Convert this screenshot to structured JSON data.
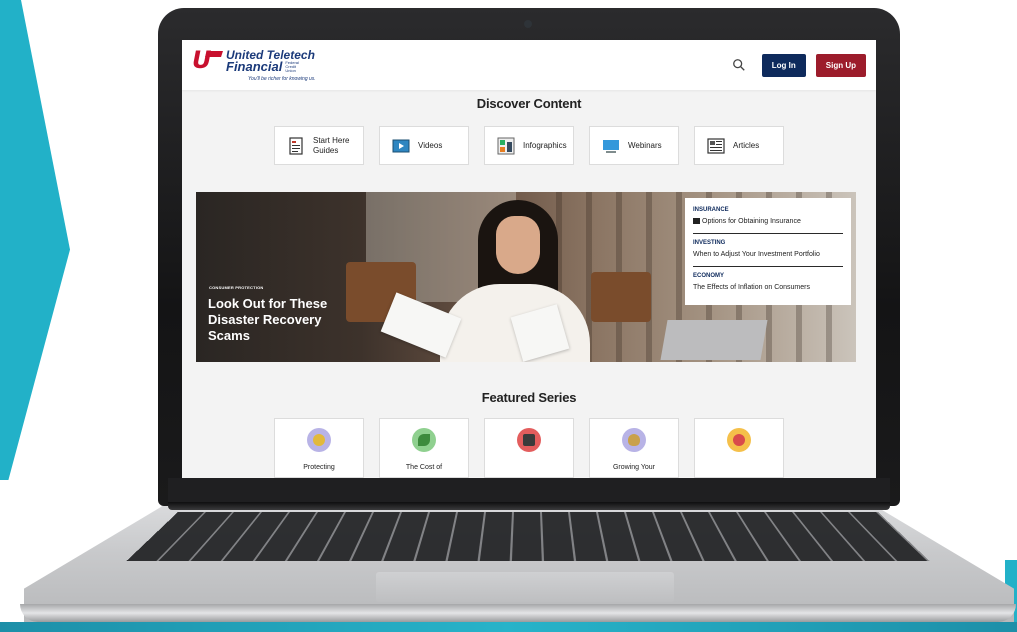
{
  "site": {
    "logo": {
      "line1": "United Teletech",
      "line2": "Financial",
      "small": "Federal Credit Union",
      "tagline": "You'll be richer for knowing us."
    },
    "header": {
      "login_label": "Log In",
      "signup_label": "Sign Up"
    },
    "discover": {
      "title": "Discover Content",
      "types": [
        {
          "label": "Start Here Guides",
          "icon": "guide-document-icon"
        },
        {
          "label": "Videos",
          "icon": "video-player-icon"
        },
        {
          "label": "Infographics",
          "icon": "infographic-icon"
        },
        {
          "label": "Webinars",
          "icon": "webinar-monitor-icon"
        },
        {
          "label": "Articles",
          "icon": "article-icon"
        }
      ]
    },
    "hero": {
      "eyebrow": "CONSUMER PROTECTION",
      "headline": "Look Out for These Disaster Recovery Scams"
    },
    "side_list": [
      {
        "category": "INSURANCE",
        "title": "Options for Obtaining Insurance"
      },
      {
        "category": "INVESTING",
        "title": "When to Adjust Your Investment Portfolio"
      },
      {
        "category": "ECONOMY",
        "title": "The Effects of Inflation on Consumers"
      }
    ],
    "featured": {
      "title": "Featured Series",
      "series": [
        {
          "label": "Protecting",
          "icon": "protection-coin-icon",
          "color": "#b8b3e6"
        },
        {
          "label": "The Cost of",
          "icon": "leaf-coin-icon",
          "color": "#8fd08f"
        },
        {
          "label": "",
          "icon": "calculator-icon",
          "color": "#e35d5d"
        },
        {
          "label": "Growing Your",
          "icon": "money-bag-icon",
          "color": "#b8b3e6"
        },
        {
          "label": "",
          "icon": "chat-bubbles-icon",
          "color": "#f5c04a"
        }
      ]
    }
  },
  "colors": {
    "brand_red": "#c8102e",
    "brand_navy": "#0e2a5c",
    "signup_red": "#9c1c2b",
    "teal_accent": "#22b1c8"
  }
}
